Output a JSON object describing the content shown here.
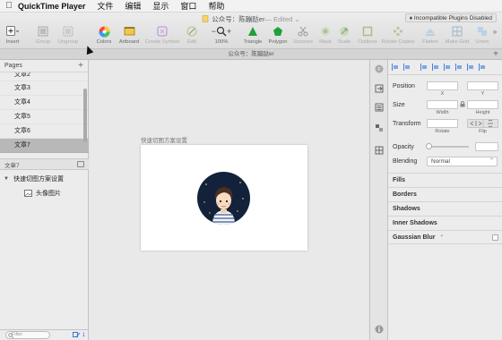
{
  "menubar": {
    "app_name": "QuickTime Player",
    "items": [
      "文件",
      "编辑",
      "显示",
      "窗口",
      "帮助"
    ]
  },
  "window": {
    "title": "公众号：陈蹦跶er",
    "edited": " — Edited ⌄",
    "plugin_badge": "♦ Incompatible Plugins Disabled"
  },
  "toolbar": {
    "insert": "Insert",
    "group": "Group",
    "ungroup": "Ungroup",
    "colors": "Colors",
    "artboard": "Artboard",
    "create_symbol": "Create Symbol",
    "edit": "Edit",
    "zoom": "100%",
    "triangle": "Triangle",
    "polygon": "Polygon",
    "scissors": "Scissors",
    "mask": "Mask",
    "scale": "Scale",
    "outlines": "Outlines",
    "rotate_copies": "Rotate Copies",
    "flatten": "Flatten",
    "make_grid": "Make Grid",
    "union": "Union",
    "more": "»",
    "zoom_minus": "−",
    "zoom_plus": "+"
  },
  "tab": {
    "label": "公众号：陈蹦跶er",
    "add": "+"
  },
  "pages": {
    "header": "Pages",
    "add": "+",
    "items": [
      {
        "label": "文章2",
        "selected": false
      },
      {
        "label": "文章3",
        "selected": false
      },
      {
        "label": "文章4",
        "selected": false
      },
      {
        "label": "文章5",
        "selected": false
      },
      {
        "label": "文章6",
        "selected": false
      },
      {
        "label": "文章7",
        "selected": true
      }
    ]
  },
  "layers": {
    "header": "文章7",
    "artboard": "快速切图方案设置",
    "image": "头像图片"
  },
  "filter": {
    "placeholder": "Filter",
    "count": "1"
  },
  "canvas": {
    "artboard_label": "快速切图方案设置"
  },
  "inspector": {
    "position": "Position",
    "x": "X",
    "y": "Y",
    "size": "Size",
    "width": "Width",
    "height": "Height",
    "transform": "Transform",
    "rotate": "Rotate",
    "flip": "Flip",
    "opacity": "Opacity",
    "blending": "Blending",
    "blending_value": "Normal",
    "fills": "Fills",
    "borders": "Borders",
    "shadows": "Shadows",
    "inner_shadows": "Inner Shadows",
    "gaussian_blur": "Gaussian Blur",
    "gaussian_chevron": "⌃"
  },
  "colors": {
    "accent": "#3b74d9",
    "avatar_bg": "#13223a",
    "selection": "#b8b8b8"
  }
}
